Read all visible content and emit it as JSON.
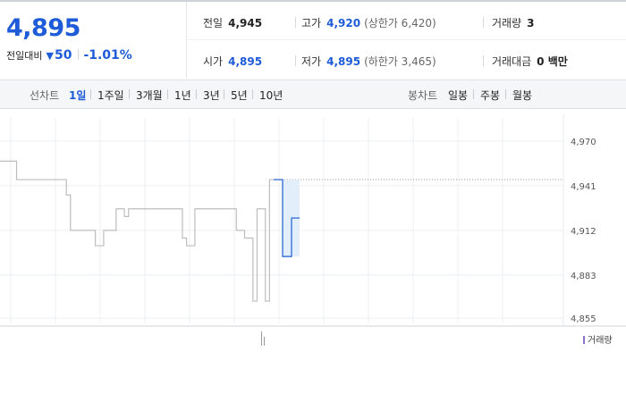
{
  "quote": {
    "price": "4,895",
    "change_label": "전일대비",
    "change_icon": "down-triangle-icon",
    "change_value": "50",
    "change_rate": "-1.01%",
    "stats": {
      "prev_close": {
        "label": "전일",
        "value": "4,945"
      },
      "high": {
        "label": "고가",
        "value": "4,920",
        "note": "(상한가 6,420)"
      },
      "volume": {
        "label": "거래량",
        "value": "3"
      },
      "open": {
        "label": "시가",
        "value": "4,895"
      },
      "low": {
        "label": "저가",
        "value": "4,895",
        "note": "(하한가 3,465)"
      },
      "trade_amount": {
        "label": "거래대금",
        "value": "0 백만"
      }
    }
  },
  "tabs": {
    "line_label": "선차트",
    "line_items": [
      "1일",
      "1주일",
      "3개월",
      "1년",
      "3년",
      "5년",
      "10년"
    ],
    "selected_line": "1일",
    "candle_label": "봉차트",
    "candle_items": [
      "일봉",
      "주봉",
      "월봉"
    ]
  },
  "colors": {
    "accent": "#1e5bd8",
    "price_line": "#bdbdbd",
    "current_line": "#3a74d6",
    "current_fill": "#e3eefb",
    "volume": "#8a74c8",
    "prev_close_line": "#9a9a9a"
  },
  "chart_data": {
    "type": "line",
    "title": "",
    "xlabel": "",
    "ylabel": "",
    "y_ticks": [
      "4,970",
      "4,941",
      "4,912",
      "4,883",
      "4,855"
    ],
    "ylim": [
      4855,
      4970
    ],
    "grid": true,
    "reference_line": {
      "name": "전일",
      "value": 4945
    },
    "series": [
      {
        "values": [
          4957,
          4957,
          4957,
          4957,
          4945,
          4945,
          4945,
          4945,
          4945,
          4945,
          4945,
          4945,
          4945,
          4945,
          4945,
          4945,
          4935,
          4912,
          4912,
          4912,
          4912,
          4912,
          4912,
          4902,
          4902,
          4912,
          4912,
          4912,
          4926,
          4926,
          4921,
          4926,
          4926,
          4926,
          4926,
          4926,
          4926,
          4926,
          4926,
          4926,
          4926,
          4926,
          4926,
          4926,
          4907,
          4902,
          4902,
          4926,
          4926,
          4926,
          4926,
          4926,
          4926,
          4926,
          4926,
          4926,
          4926,
          4912,
          4912,
          4907,
          4907,
          4866,
          4926,
          4926,
          4866,
          4945,
          4945
        ]
      },
      {
        "values": [
          4945,
          4945,
          4895,
          4895,
          4920,
          4920
        ]
      }
    ],
    "volume": {
      "name": "거래량",
      "legend": "거래량",
      "values": [
        2,
        1
      ]
    }
  }
}
